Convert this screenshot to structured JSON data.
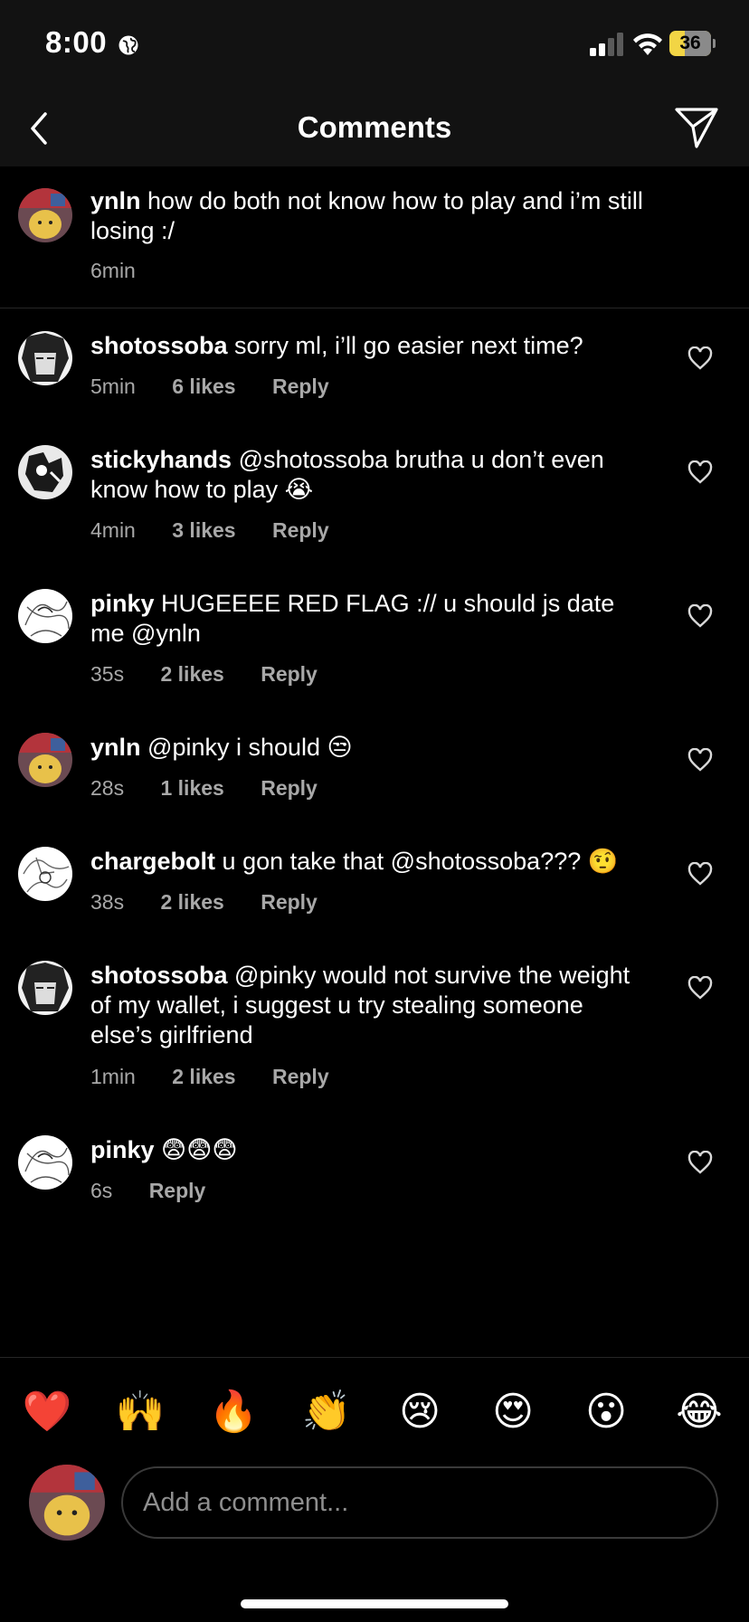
{
  "status_bar": {
    "time": "8:00",
    "battery": "36",
    "battery_level": 0.36,
    "icons": [
      "globe-icon",
      "cellular-signal-icon",
      "wifi-icon",
      "battery-icon"
    ]
  },
  "header": {
    "title": "Comments",
    "back_icon": "chevron-left-icon",
    "share_icon": "paper-plane-icon"
  },
  "caption": {
    "username": "ynln",
    "text": "how do both not know how to play and i’m still losing :/",
    "time": "6min"
  },
  "comments": [
    {
      "username": "shotossoba",
      "text": "sorry ml, i’ll go easier next time?",
      "time": "5min",
      "likes": "6 likes",
      "reply": "Reply"
    },
    {
      "username": "stickyhands",
      "text": "@shotossoba brutha u don’t even know how to play 😭",
      "time": "4min",
      "likes": "3 likes",
      "reply": "Reply"
    },
    {
      "username": "pinky",
      "text": "HUGEEEE RED FLAG :// u should js date me @ynln",
      "time": "35s",
      "likes": "2 likes",
      "reply": "Reply"
    },
    {
      "username": "ynln",
      "text": "@pinky i should 😒",
      "time": "28s",
      "likes": "1 likes",
      "reply": "Reply"
    },
    {
      "username": "chargebolt",
      "text": "u gon take that @shotossoba??? 🤨",
      "time": "38s",
      "likes": "2 likes",
      "reply": "Reply"
    },
    {
      "username": "shotossoba",
      "text": "@pinky would not survive the weight of my wallet, i suggest u try stealing someone else’s girlfriend",
      "time": "1min",
      "likes": "2 likes",
      "reply": "Reply"
    },
    {
      "username": "pinky",
      "text": "😨😨😨",
      "time": "6s",
      "reply": "Reply"
    }
  ],
  "reactions": [
    "❤️",
    "🙌",
    "🔥",
    "👏",
    "😢",
    "😍",
    "😮",
    "😂"
  ],
  "composer": {
    "placeholder": "Add a comment..."
  },
  "colors": {
    "background": "#000000",
    "header_bg": "#121212",
    "secondary_text": "#a8a8a8",
    "divider": "#262626",
    "battery_yellow": "#f2d545"
  }
}
